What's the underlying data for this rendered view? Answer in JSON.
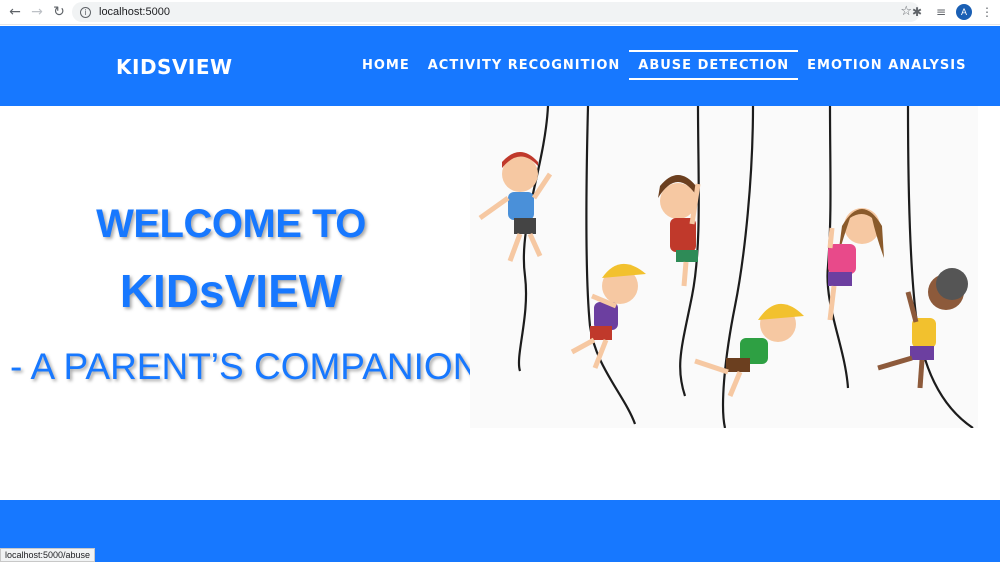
{
  "browser": {
    "url": "localhost:5000",
    "profile_initial": "A",
    "status_url": "localhost:5000/abuse"
  },
  "site": {
    "logo": "KIDSVIEW",
    "nav": [
      {
        "label": "HOME",
        "active": false
      },
      {
        "label": "ACTIVITY RECOGNITION",
        "active": false
      },
      {
        "label": "ABUSE DETECTION",
        "active": true
      },
      {
        "label": "EMOTION ANALYSIS",
        "active": false
      }
    ]
  },
  "hero": {
    "line1": "WELCOME TO",
    "line2": "KIDsVIEW",
    "line3": "- A PARENT’S COMPANION"
  },
  "colors": {
    "brand": "#1778ff",
    "white": "#ffffff"
  },
  "icons": [
    "back-icon",
    "forward-icon",
    "reload-icon",
    "info-icon",
    "star-icon",
    "extensions-icon",
    "reading-list-icon",
    "menu-icon"
  ]
}
